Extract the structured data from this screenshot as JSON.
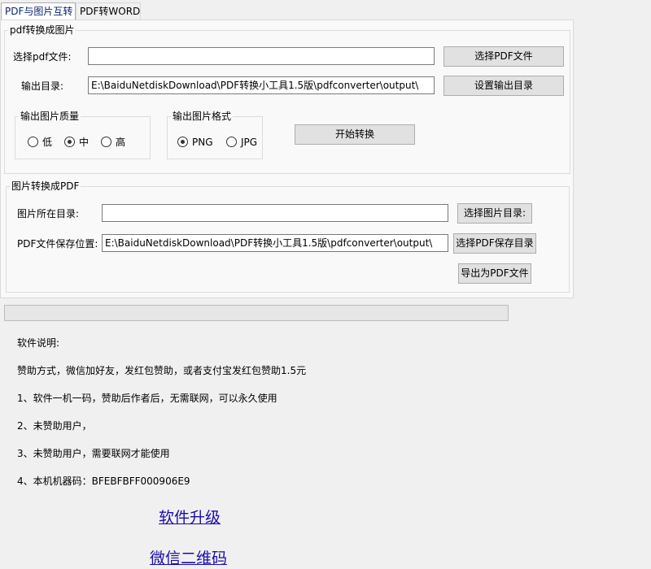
{
  "tabs": [
    {
      "label": "PDF与图片互转",
      "active": true
    },
    {
      "label": "PDF转WORD",
      "active": false
    }
  ],
  "pdf_to_image": {
    "legend": "pdf转换成图片",
    "file_label": "选择pdf文件:",
    "file_value": "",
    "file_button": "选择PDF文件",
    "outdir_label": "输出目录:",
    "outdir_value": "E:\\BaiduNetdiskDownload\\PDF转换小工具1.5版\\pdfconverter\\output\\",
    "outdir_button": "设置输出目录",
    "quality": {
      "legend": "输出图片质量",
      "options": [
        {
          "label": "低",
          "checked": false
        },
        {
          "label": "中",
          "checked": true
        },
        {
          "label": "高",
          "checked": false
        }
      ]
    },
    "format": {
      "legend": "输出图片格式",
      "options": [
        {
          "label": "PNG",
          "checked": true
        },
        {
          "label": "JPG",
          "checked": false
        }
      ]
    },
    "start_button": "开始转换"
  },
  "image_to_pdf": {
    "legend": "图片转换成PDF",
    "imgdir_label": "图片所在目录:",
    "imgdir_value": "",
    "imgdir_button": "选择图片目录:",
    "save_label": "PDF文件保存位置:",
    "save_value": "E:\\BaiduNetdiskDownload\\PDF转换小工具1.5版\\pdfconverter\\output\\",
    "save_button": "选择PDF保存目录",
    "export_button": "导出为PDF文件"
  },
  "progress": {
    "value": 0
  },
  "notes": [
    "软件说明:",
    "赞助方式，微信加好友，发红包赞助，或者支付宝发红包赞助1.5元",
    "1、软件一机一码，赞助后作者后，无需联网，可以永久使用",
    "2、未赞助用户，",
    "3、未赞助用户，需要联网才能使用",
    "4、本机机器码：BFEBFBFF000906E9"
  ],
  "links": {
    "upgrade": "软件升级",
    "wechat_qr": "微信二维码"
  },
  "colors": {
    "window_bg": "#f0f0f0",
    "panel_bg": "#f9f9f9",
    "button_bg": "#e1e1e1",
    "link": "#1a0dab"
  }
}
